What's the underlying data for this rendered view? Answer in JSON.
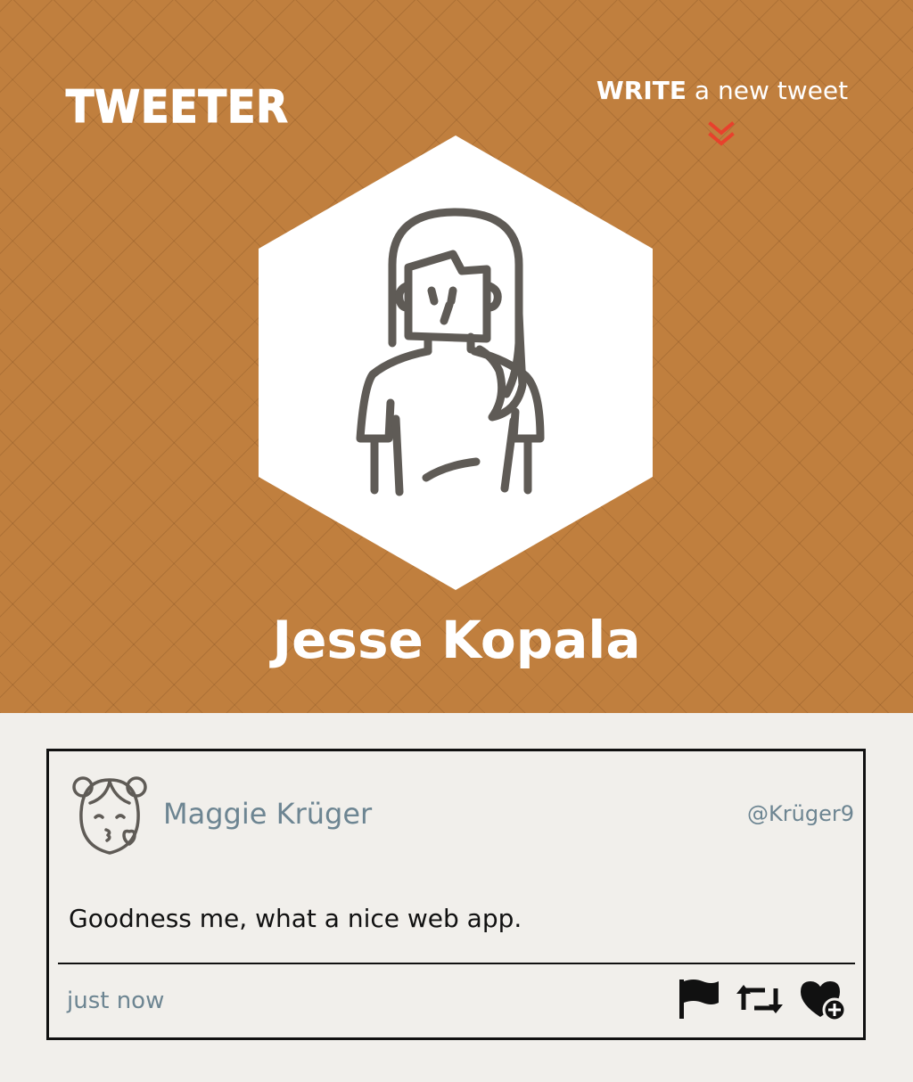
{
  "header": {
    "brand": "TWEETER",
    "write_link": {
      "strong": "WRITE",
      "rest": " a new tweet"
    },
    "profile_name": "Jesse Kopala"
  },
  "tweet": {
    "author_name": "Maggie Krüger",
    "handle": "@Krüger9",
    "text": "Goodness me, what a nice web app.",
    "timestamp": "just now",
    "actions": [
      "flag-icon",
      "retweet-icon",
      "heart-plus-icon"
    ]
  },
  "colors": {
    "header_bg": "#c07f3e",
    "page_bg": "#f1efeb",
    "accent_red": "#e8412c",
    "muted_text": "#6d8592",
    "icon_gray": "#5f5b56"
  }
}
